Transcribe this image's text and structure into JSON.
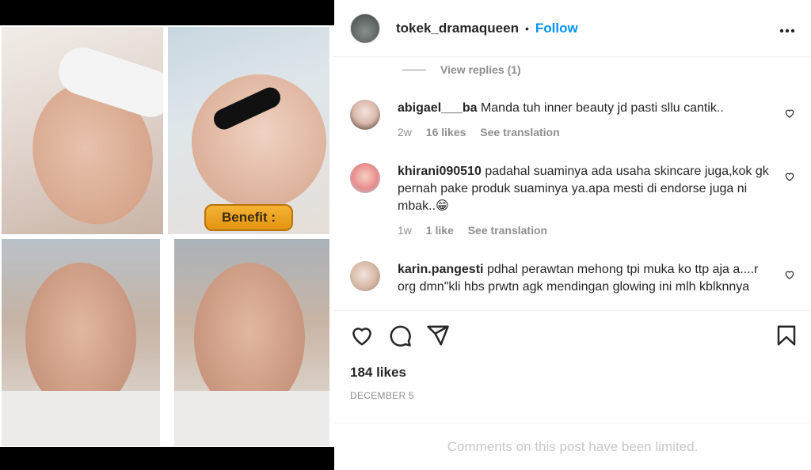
{
  "media": {
    "benefit_label": "Benefit :"
  },
  "post": {
    "username": "tokek_dramaqueen",
    "separator": "•",
    "follow_label": "Follow",
    "more_label": "•••"
  },
  "view_replies": "View replies (1)",
  "comments": [
    {
      "username": "abigael___ba",
      "text": "Manda tuh inner beauty jd pasti sllu cantik..",
      "age": "2w",
      "likes": "16 likes",
      "translate": "See translation"
    },
    {
      "username": "khirani090510",
      "text": "padahal suaminya ada usaha skincare juga,kok gk pernah pake produk suaminya ya.apa mesti di endorse juga ni mbak..😁",
      "age": "1w",
      "likes": "1 like",
      "translate": "See translation"
    },
    {
      "username": "karin.pangesti",
      "text": "pdhal perawtan mehong tpi muka ko ttp aja a....r org dmn\"kli hbs prwtn agk mendingan glowing ini mlh kblknnya",
      "age": "",
      "likes": "",
      "translate": ""
    }
  ],
  "likes_count": "184 likes",
  "date": "DECEMBER 5",
  "limited_text": "Comments on this post have been limited."
}
